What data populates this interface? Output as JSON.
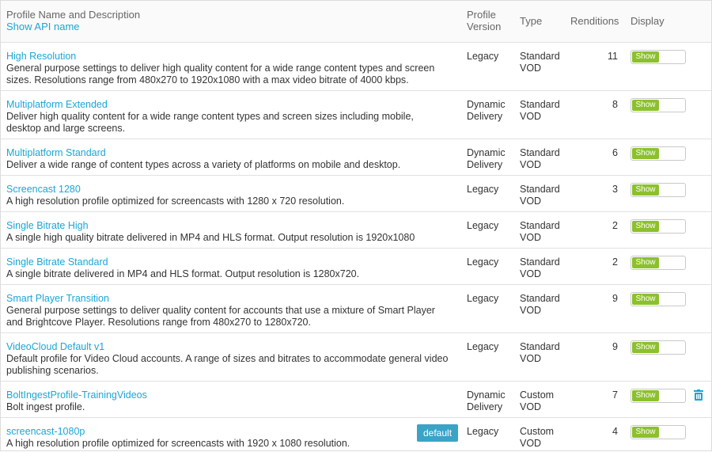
{
  "header": {
    "name_col": "Profile Name and Description",
    "show_api": "Show API name",
    "version_col_1": "Profile",
    "version_col_2": "Version",
    "type_col": "Type",
    "renditions_col": "Renditions",
    "display_col": "Display"
  },
  "toggle_label": "Show",
  "badge_label": "default",
  "colors": {
    "link": "#1aa6d8",
    "toggle_on": "#8cc02d",
    "badge": "#3aa3c6"
  },
  "rows": [
    {
      "name": "High Resolution",
      "desc": "General purpose settings to deliver high quality content for a wide range content types and screen sizes. Resolutions range from 480x270 to 1920x1080 with a max video bitrate of 4000 kbps.",
      "version": "Legacy",
      "type": "Standard VOD",
      "renditions": "11"
    },
    {
      "name": "Multiplatform Extended",
      "desc": "Deliver high quality content for a wide range content types and screen sizes including mobile, desktop and large screens.",
      "version": "Dynamic Delivery",
      "type": "Standard VOD",
      "renditions": "8"
    },
    {
      "name": "Multiplatform Standard",
      "desc": "Deliver a wide range of content types across a variety of platforms on mobile and desktop.",
      "version": "Dynamic Delivery",
      "type": "Standard VOD",
      "renditions": "6"
    },
    {
      "name": "Screencast 1280",
      "desc": "A high resolution profile optimized for screencasts with 1280 x 720 resolution.",
      "version": "Legacy",
      "type": "Standard VOD",
      "renditions": "3"
    },
    {
      "name": "Single Bitrate High",
      "desc": "A single high quality bitrate delivered in MP4 and HLS format. Output resolution is 1920x1080",
      "version": "Legacy",
      "type": "Standard VOD",
      "renditions": "2"
    },
    {
      "name": "Single Bitrate Standard",
      "desc": "A single bitrate delivered in MP4 and HLS format. Output resolution is 1280x720.",
      "version": "Legacy",
      "type": "Standard VOD",
      "renditions": "2"
    },
    {
      "name": "Smart Player Transition",
      "desc": "General purpose settings to deliver quality content for accounts that use a mixture of Smart Player and Brightcove Player. Resolutions range from 480x270 to 1280x720.",
      "version": "Legacy",
      "type": "Standard VOD",
      "renditions": "9"
    },
    {
      "name": "VideoCloud Default v1",
      "desc": "Default profile for Video Cloud accounts. A range of sizes and bitrates to accommodate general video publishing scenarios.",
      "version": "Legacy",
      "type": "Standard VOD",
      "renditions": "9"
    },
    {
      "name": "BoltIngestProfile-TrainingVideos",
      "desc": "Bolt ingest profile.",
      "version": "Dynamic Delivery",
      "type": "Custom VOD",
      "renditions": "7"
    },
    {
      "name": "screencast-1080p",
      "desc": "A high resolution profile optimized for screencasts with 1920 x 1080 resolution.",
      "version": "Legacy",
      "type": "Custom VOD",
      "renditions": "4"
    }
  ]
}
